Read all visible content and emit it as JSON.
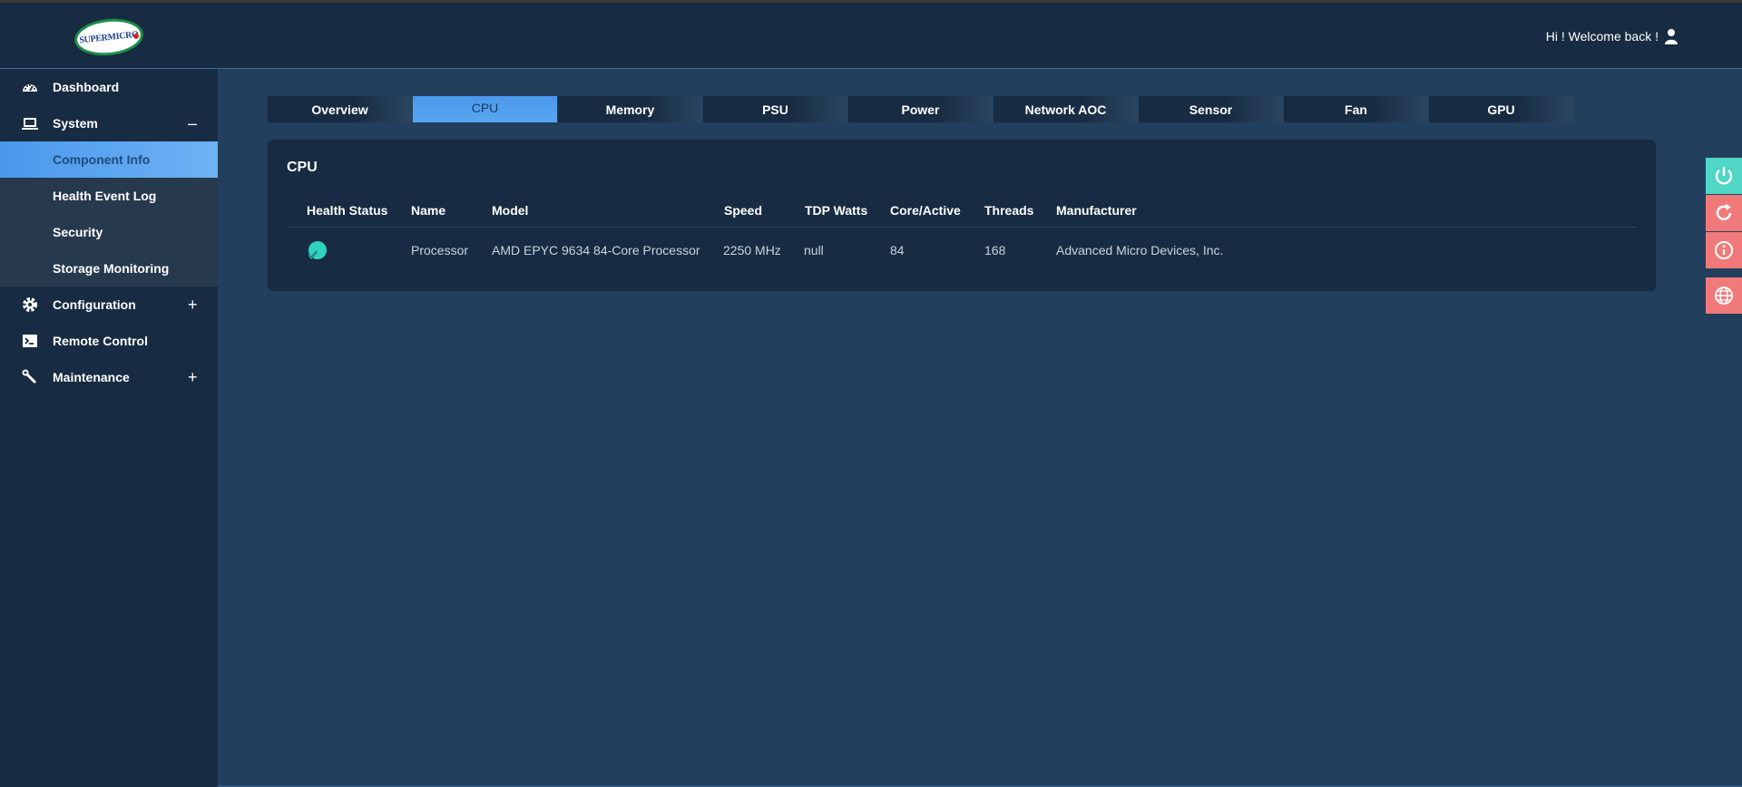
{
  "header": {
    "logo_text": "SUPERMICRO",
    "welcome": "Hi ! Welcome back !"
  },
  "sidebar": {
    "items": [
      {
        "label": "Dashboard",
        "icon": "dashboard-icon"
      },
      {
        "label": "System",
        "icon": "laptop-icon",
        "toggle": "–"
      },
      {
        "label": "Configuration",
        "icon": "gear-icon",
        "toggle": "+"
      },
      {
        "label": "Remote Control",
        "icon": "terminal-icon"
      },
      {
        "label": "Maintenance",
        "icon": "wrench-icon",
        "toggle": "+"
      }
    ],
    "system_sub": [
      {
        "label": "Component Info",
        "active": true
      },
      {
        "label": "Health Event Log"
      },
      {
        "label": "Security"
      },
      {
        "label": "Storage Monitoring"
      }
    ]
  },
  "tabs": [
    {
      "label": "Overview"
    },
    {
      "label": "CPU",
      "active": true
    },
    {
      "label": "Memory"
    },
    {
      "label": "PSU"
    },
    {
      "label": "Power"
    },
    {
      "label": "Network AOC"
    },
    {
      "label": "Sensor"
    },
    {
      "label": "Fan"
    },
    {
      "label": "GPU"
    }
  ],
  "cpu": {
    "title": "CPU",
    "columns": [
      "Health Status",
      "Name",
      "Model",
      "Speed",
      "TDP Watts",
      "Core/Active",
      "Threads",
      "Manufacturer"
    ],
    "rows": [
      {
        "health": "ok",
        "name": "Processor",
        "model": "AMD EPYC 9634 84-Core Processor",
        "speed": "2250 MHz",
        "tdp": "null",
        "cores": "84",
        "threads": "168",
        "manufacturer": "Advanced Micro Devices, Inc."
      }
    ]
  },
  "side_buttons": [
    {
      "name": "power-icon",
      "color": "#4fd6c4"
    },
    {
      "name": "refresh-icon",
      "color": "#f07a7a"
    },
    {
      "name": "info-icon",
      "color": "#f07a7a"
    },
    {
      "name": "globe-icon",
      "color": "#f07a7a"
    }
  ],
  "colors": {
    "accent": "#4a98ec",
    "health_ok": "#2ed3c0",
    "sidebar_bg": "#172b42",
    "content_bg": "#22405e"
  }
}
